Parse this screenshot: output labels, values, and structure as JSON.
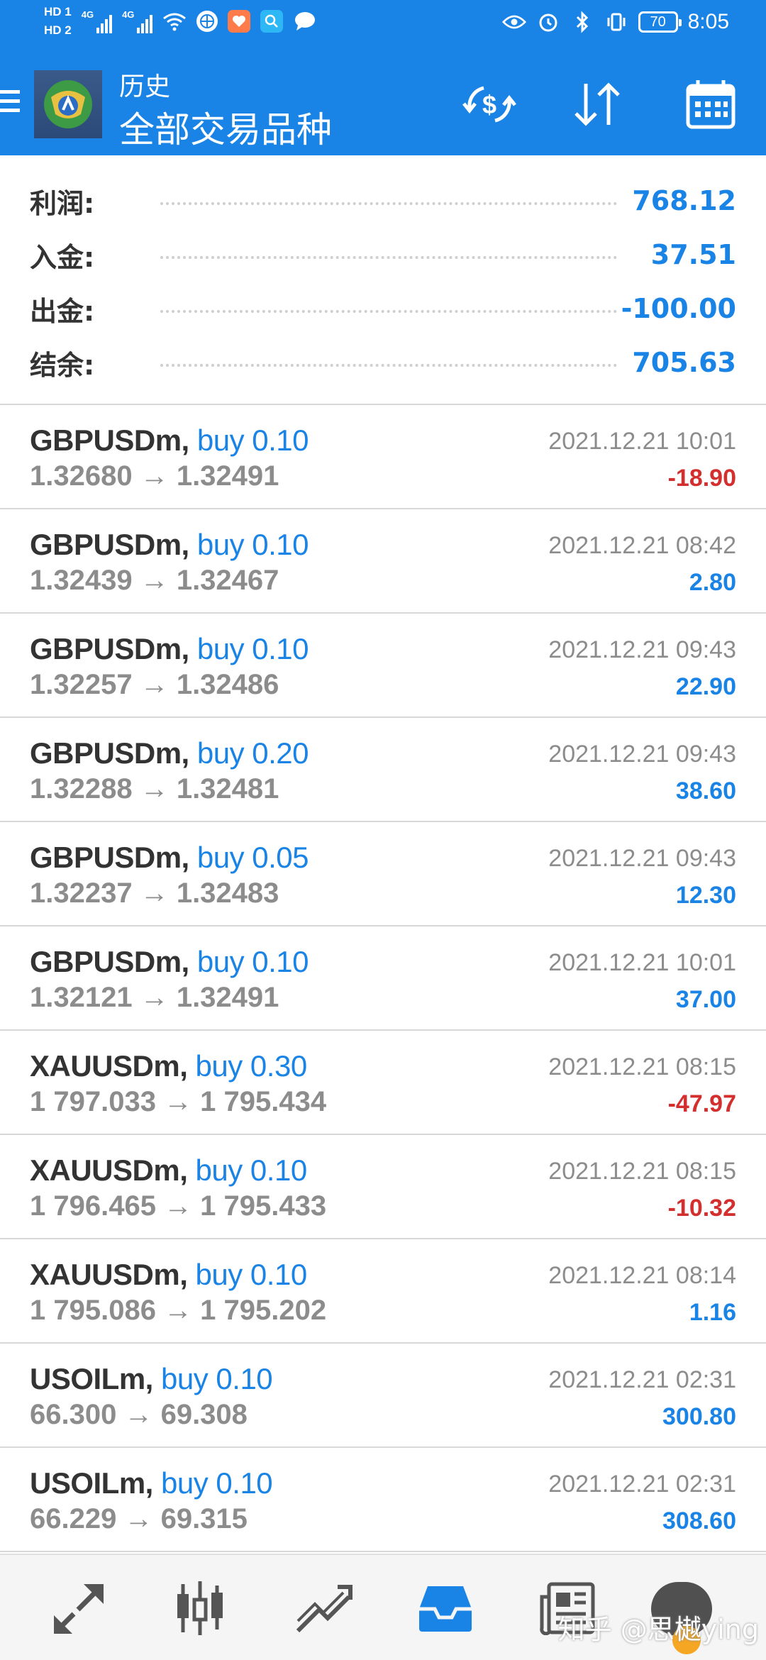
{
  "status_bar": {
    "hd1": "HD 1",
    "hd2": "HD 2",
    "net1": "4G",
    "net2": "4G",
    "battery": "70",
    "time": "8:05"
  },
  "header": {
    "subtitle": "历史",
    "title": "全部交易品种"
  },
  "summary": [
    {
      "label": "利润:",
      "value": "768.12"
    },
    {
      "label": "入金:",
      "value": "37.51"
    },
    {
      "label": "出金:",
      "value": "-100.00"
    },
    {
      "label": "结余:",
      "value": "705.63"
    }
  ],
  "trades": [
    {
      "symbol": "GBPUSDm,",
      "side": "buy 0.10",
      "prices": "1.32680 → 1.32491",
      "time": "2021.12.21 10:01",
      "pl": "-18.90"
    },
    {
      "symbol": "GBPUSDm,",
      "side": "buy 0.10",
      "prices": "1.32439 → 1.32467",
      "time": "2021.12.21 08:42",
      "pl": "2.80"
    },
    {
      "symbol": "GBPUSDm,",
      "side": "buy 0.10",
      "prices": "1.32257 → 1.32486",
      "time": "2021.12.21 09:43",
      "pl": "22.90"
    },
    {
      "symbol": "GBPUSDm,",
      "side": "buy 0.20",
      "prices": "1.32288 → 1.32481",
      "time": "2021.12.21 09:43",
      "pl": "38.60"
    },
    {
      "symbol": "GBPUSDm,",
      "side": "buy 0.05",
      "prices": "1.32237 → 1.32483",
      "time": "2021.12.21 09:43",
      "pl": "12.30"
    },
    {
      "symbol": "GBPUSDm,",
      "side": "buy 0.10",
      "prices": "1.32121 → 1.32491",
      "time": "2021.12.21 10:01",
      "pl": "37.00"
    },
    {
      "symbol": "XAUUSDm,",
      "side": "buy 0.30",
      "prices": "1 797.033 → 1 795.434",
      "time": "2021.12.21 08:15",
      "pl": "-47.97"
    },
    {
      "symbol": "XAUUSDm,",
      "side": "buy 0.10",
      "prices": "1 796.465 → 1 795.433",
      "time": "2021.12.21 08:15",
      "pl": "-10.32"
    },
    {
      "symbol": "XAUUSDm,",
      "side": "buy 0.10",
      "prices": "1 795.086 → 1 795.202",
      "time": "2021.12.21 08:14",
      "pl": "1.16"
    },
    {
      "symbol": "USOILm,",
      "side": "buy 0.10",
      "prices": "66.300 → 69.308",
      "time": "2021.12.21 02:31",
      "pl": "300.80"
    },
    {
      "symbol": "USOILm,",
      "side": "buy 0.10",
      "prices": "66.229 → 69.315",
      "time": "2021.12.21 02:31",
      "pl": "308.60"
    }
  ],
  "colors": {
    "accent": "#1a84e6",
    "negative": "#d32f2f",
    "muted": "#8c8c8c"
  },
  "icons": {
    "appbar": [
      "currency-exchange-icon",
      "sort-icon",
      "calendar-icon"
    ],
    "bottom_nav": [
      "trade-arrows-icon",
      "candlestick-icon",
      "chart-trend-icon",
      "history-inbox-icon",
      "news-icon",
      "chat-icon"
    ]
  },
  "watermark": "知乎 @思樾ying"
}
